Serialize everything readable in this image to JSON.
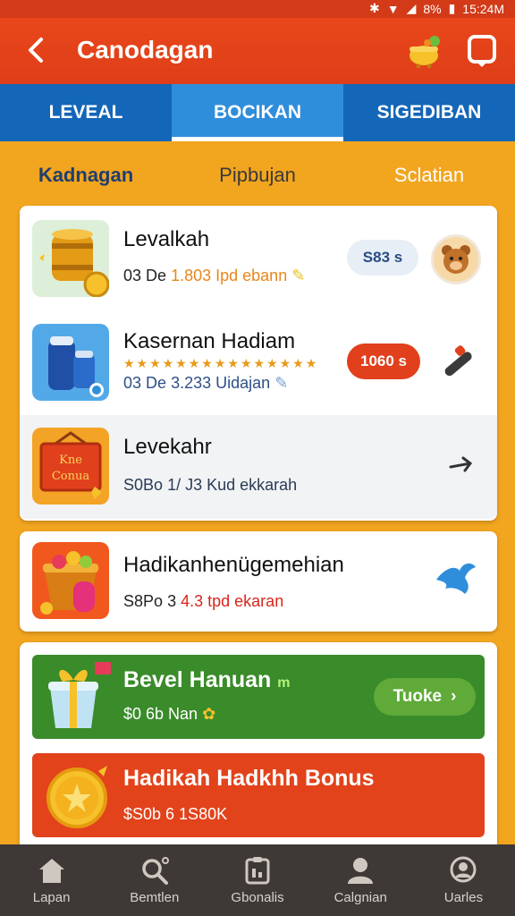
{
  "status_bar": {
    "battery": "8%",
    "time": "15:24M"
  },
  "app_bar": {
    "title": "Canodagan"
  },
  "tabs": [
    {
      "label": "LEVEAL",
      "active": false
    },
    {
      "label": "BOCIKAN",
      "active": true
    },
    {
      "label": "SIGEDIBAN",
      "active": false
    }
  ],
  "subtabs": [
    {
      "label": "Kadnagan",
      "color": "#1F3E6E"
    },
    {
      "label": "Pipbujan",
      "color": "#3A3A3A"
    },
    {
      "label": "Sclatian",
      "color": "#FFFFFF"
    }
  ],
  "list": [
    {
      "title": "Levalkah",
      "sub_prefix": "03 De",
      "sub_value": "1.803",
      "sub_suffix": "Ipd ebann",
      "badge": "S83 s"
    },
    {
      "title": "Kasernan Hadiam",
      "stars": "★★★★★★★★★★★★★★★",
      "sub_prefix": "03 De",
      "sub_value": "3.233",
      "sub_suffix": "Uidajan",
      "badge": "1060 s"
    },
    {
      "title": "Levekahr",
      "sub_prefix": "S0Bo",
      "sub_value": "1/ J3",
      "sub_suffix": "Kud ekkarah",
      "thumb_text": "Kne Conua"
    },
    {
      "title": "Hadikanhenügemehian",
      "sub_prefix": "S8Po",
      "sub_value": "3",
      "sub_value2": "4.3",
      "sub_suffix": "tpd ekaran"
    }
  ],
  "promos": [
    {
      "title": "Bevel Hanuan",
      "title_suffix": "m",
      "sub": "$0 6b Nan",
      "button": "Tuoke"
    },
    {
      "title": "Hadikah Hadkhh Bonus",
      "sub": "$S0b 6 1S80K"
    }
  ],
  "bottom_nav": [
    {
      "label": "Lapan",
      "icon": "home-icon"
    },
    {
      "label": "Bemtlen",
      "icon": "search-icon"
    },
    {
      "label": "Gbonalis",
      "icon": "clipboard-icon"
    },
    {
      "label": "Calgnian",
      "icon": "user-icon"
    },
    {
      "label": "Uarles",
      "icon": "profile-icon"
    }
  ],
  "colors": {
    "primary": "#E2431B",
    "tab_bar": "#1466B8",
    "active_tab": "#2F8EDB",
    "background": "#F2A51F",
    "nav": "#3E3936",
    "green": "#3A8B2A"
  }
}
